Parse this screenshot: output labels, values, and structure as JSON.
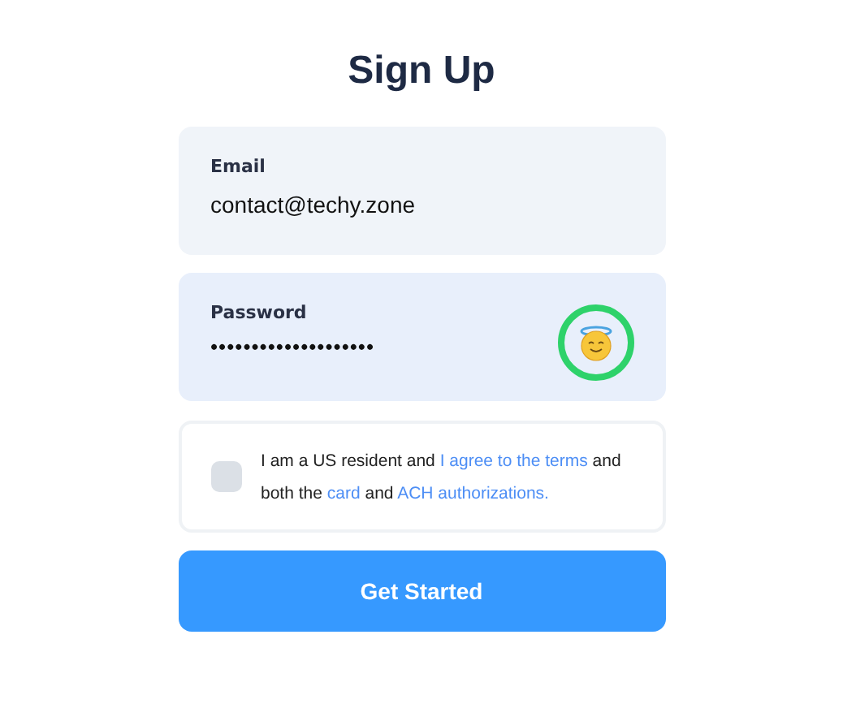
{
  "title": "Sign Up",
  "email": {
    "label": "Email",
    "value": "contact@techy.zone"
  },
  "password": {
    "label": "Password",
    "value": "••••••••••••••••••••"
  },
  "agreement": {
    "checked": false,
    "parts": [
      {
        "kind": "text",
        "text": "I am a US resident and "
      },
      {
        "kind": "link",
        "text": "I agree to the terms"
      },
      {
        "kind": "text",
        "text": " and both the "
      },
      {
        "kind": "link",
        "text": "card"
      },
      {
        "kind": "text",
        "text": " and "
      },
      {
        "kind": "link",
        "text": "ACH authorizations."
      }
    ]
  },
  "button": "Get Started"
}
